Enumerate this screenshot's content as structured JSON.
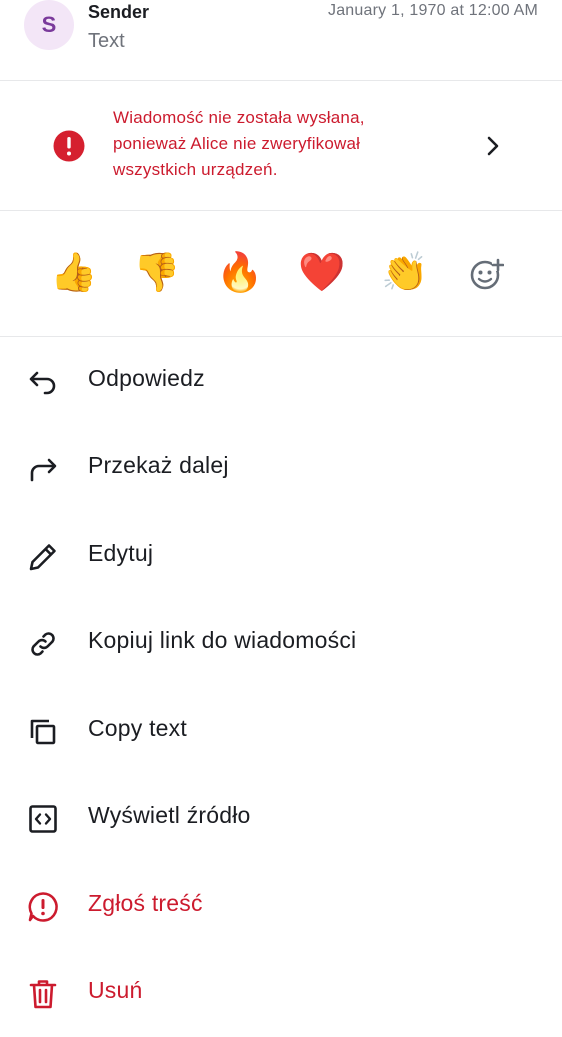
{
  "message": {
    "avatar_initial": "S",
    "sender": "Sender",
    "text": "Text",
    "timestamp": "January 1, 1970 at 12:00 AM"
  },
  "warning": {
    "text": "Wiadomość nie została wysłana, ponieważ Alice nie zweryfikował wszystkich urządzeń.",
    "icon": "error-icon",
    "chevron": "chevron-right-icon"
  },
  "reactions": {
    "items": [
      "👍",
      "👎",
      "🔥",
      "❤️",
      "👏"
    ],
    "add_icon": "add-reaction-icon"
  },
  "menu": {
    "items": [
      {
        "label": "Odpowiedz",
        "icon": "reply-icon"
      },
      {
        "label": "Przekaż dalej",
        "icon": "forward-icon"
      },
      {
        "label": "Edytuj",
        "icon": "edit-pencil-icon"
      },
      {
        "label": "Kopiuj link do wiadomości",
        "icon": "link-icon"
      },
      {
        "label": "Copy text",
        "icon": "copy-icon"
      },
      {
        "label": "Wyświetl źródło",
        "icon": "code-icon"
      },
      {
        "label": "Zgłoś treść",
        "icon": "report-icon"
      },
      {
        "label": "Usuń",
        "icon": "delete-icon"
      }
    ]
  },
  "colors": {
    "danger": "#cc1b2e",
    "divider": "#e7e8ea",
    "avatar_bg": "#f3e6f7",
    "avatar_fg": "#7a3a9b"
  }
}
